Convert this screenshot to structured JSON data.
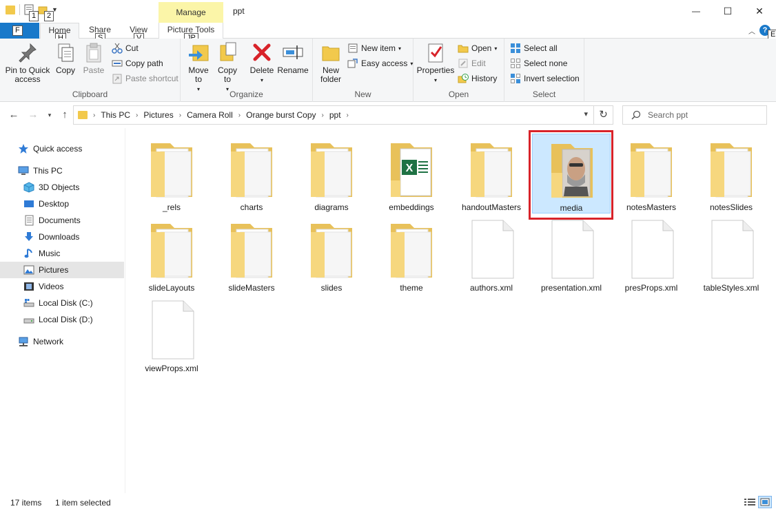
{
  "window": {
    "title": "ppt",
    "contextual_group": "Manage",
    "minimize_glyph": "—",
    "maximize_glyph": "☐",
    "close_glyph": "✕"
  },
  "qat": {
    "keytip_1": "1",
    "keytip_2": "2"
  },
  "tabs": {
    "file": "F",
    "home": "Home",
    "share": "Share",
    "view": "View",
    "picture_tools": "Picture Tools",
    "keytip_home": "H",
    "keytip_share": "S",
    "keytip_view": "V",
    "keytip_picture_tools": "JP",
    "keytip_help": "E"
  },
  "ribbon": {
    "clipboard": {
      "label": "Clipboard",
      "pin": "Pin to Quick access",
      "copy": "Copy",
      "paste": "Paste",
      "cut": "Cut",
      "copy_path": "Copy path",
      "paste_shortcut": "Paste shortcut"
    },
    "organize": {
      "label": "Organize",
      "move_to": "Move to",
      "copy_to": "Copy to",
      "delete": "Delete",
      "rename": "Rename"
    },
    "new": {
      "label": "New",
      "new_folder": "New folder",
      "new_item": "New item",
      "easy_access": "Easy access"
    },
    "open": {
      "label": "Open",
      "properties": "Properties",
      "open": "Open",
      "edit": "Edit",
      "history": "History"
    },
    "select": {
      "label": "Select",
      "select_all": "Select all",
      "select_none": "Select none",
      "invert_selection": "Invert selection"
    }
  },
  "address": {
    "crumbs": [
      "This PC",
      "Pictures",
      "Camera Roll",
      "Orange burst Copy",
      "ppt"
    ],
    "search_placeholder": "Search ppt"
  },
  "navpane": {
    "quick_access": "Quick access",
    "this_pc": "This PC",
    "objects3d": "3D Objects",
    "desktop": "Desktop",
    "documents": "Documents",
    "downloads": "Downloads",
    "music": "Music",
    "pictures": "Pictures",
    "videos": "Videos",
    "local_c": "Local Disk (C:)",
    "local_d": "Local Disk (D:)",
    "network": "Network"
  },
  "items": [
    {
      "name": "_rels",
      "type": "folder"
    },
    {
      "name": "charts",
      "type": "folder"
    },
    {
      "name": "diagrams",
      "type": "folder"
    },
    {
      "name": "embeddings",
      "type": "folder-excel"
    },
    {
      "name": "handoutMasters",
      "type": "folder"
    },
    {
      "name": "media",
      "type": "folder-photo",
      "selected": true
    },
    {
      "name": "notesMasters",
      "type": "folder"
    },
    {
      "name": "notesSlides",
      "type": "folder"
    },
    {
      "name": "slideLayouts",
      "type": "folder"
    },
    {
      "name": "slideMasters",
      "type": "folder"
    },
    {
      "name": "slides",
      "type": "folder"
    },
    {
      "name": "theme",
      "type": "folder"
    },
    {
      "name": "authors.xml",
      "type": "file"
    },
    {
      "name": "presentation.xml",
      "type": "file"
    },
    {
      "name": "presProps.xml",
      "type": "file"
    },
    {
      "name": "tableStyles.xml",
      "type": "file"
    },
    {
      "name": "viewProps.xml",
      "type": "file"
    }
  ],
  "status": {
    "count": "17 items",
    "selection": "1 item selected"
  }
}
